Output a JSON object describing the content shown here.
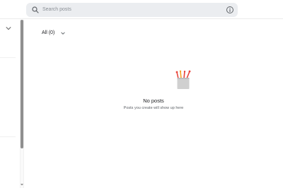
{
  "search": {
    "placeholder": "Search posts",
    "search_icon": "search-icon",
    "info_icon": "info-icon"
  },
  "filter": {
    "label": "All (0)",
    "icon": "chevron-down-icon"
  },
  "empty_state": {
    "illustration": "pencil-cup-illustration",
    "title": "No posts",
    "subtitle": "Posts you create will show up here"
  },
  "sidebar": {
    "toggle_icon": "chevron-down-icon"
  },
  "colors": {
    "search_bg": "#ebedf0",
    "scrollbar_thumb": "#8f8f8f",
    "pencil_red": "#e8453c",
    "pencil_orange": "#f4a023",
    "cup_gray": "#d0d0d0"
  }
}
